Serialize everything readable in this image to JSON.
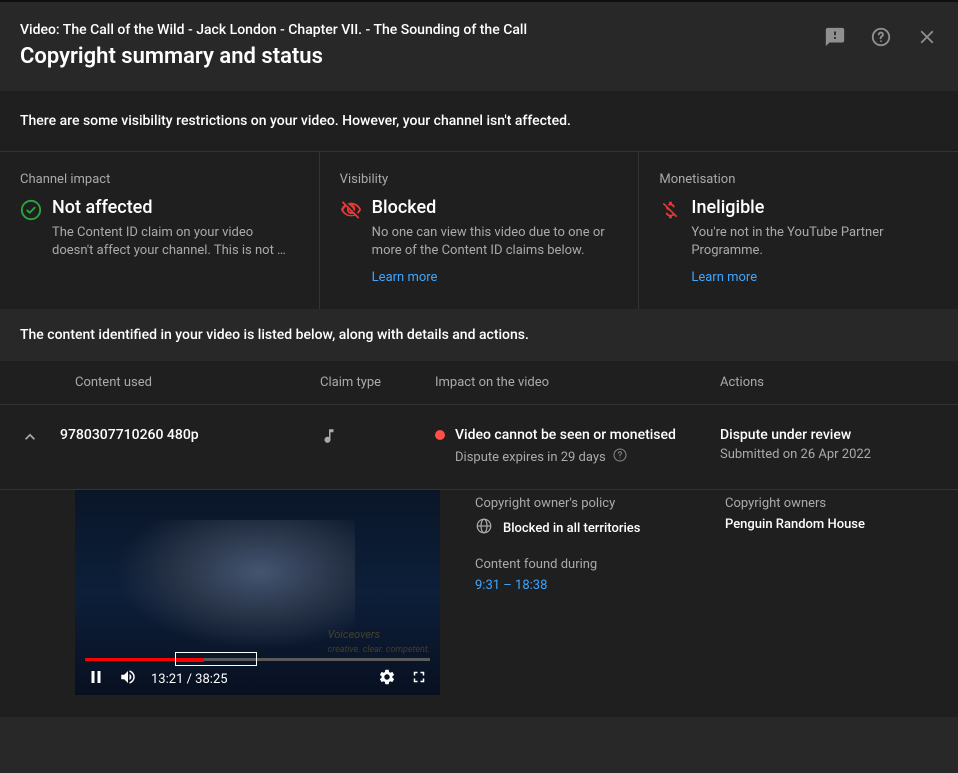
{
  "header": {
    "breadcrumb": "Video: The Call of the Wild - Jack London - Chapter VII. - The Sounding of the Call",
    "title": "Copyright summary and status"
  },
  "notice": "There are some visibility restrictions on your video. However, your channel isn't affected.",
  "panels": {
    "channel": {
      "label": "Channel impact",
      "status": "Not affected",
      "desc": "The Content ID claim on your video doesn't affect your channel. This is not …"
    },
    "visibility": {
      "label": "Visibility",
      "status": "Blocked",
      "desc": "No one can view this video due to one or more of the Content ID claims below.",
      "learn_more": "Learn more"
    },
    "monetisation": {
      "label": "Monetisation",
      "status": "Ineligible",
      "desc": "You're not in the YouTube Partner Programme.",
      "learn_more": "Learn more"
    }
  },
  "claims_intro": "The content identified in your video is listed below, along with details and actions.",
  "table": {
    "headers": {
      "content": "Content used",
      "claim_type": "Claim type",
      "impact": "Impact on the video",
      "actions": "Actions"
    },
    "row": {
      "content_title": "9780307710260 480p",
      "impact_title": "Video cannot be seen or monetised",
      "impact_sub": "Dispute expires in 29 days",
      "action_title": "Dispute under review",
      "action_sub": "Submitted on 26 Apr 2022"
    }
  },
  "details": {
    "policy_label": "Copyright owner's policy",
    "policy_value": "Blocked in all territories",
    "found_label": "Content found during",
    "found_value": "9:31 – 18:38",
    "owners_label": "Copyright owners",
    "owners_value": "Penguin Random House"
  },
  "player": {
    "time": "13:21 / 38:25",
    "watermark_line1": "Voiceovers",
    "watermark_line2": "creative. clear. competent."
  }
}
